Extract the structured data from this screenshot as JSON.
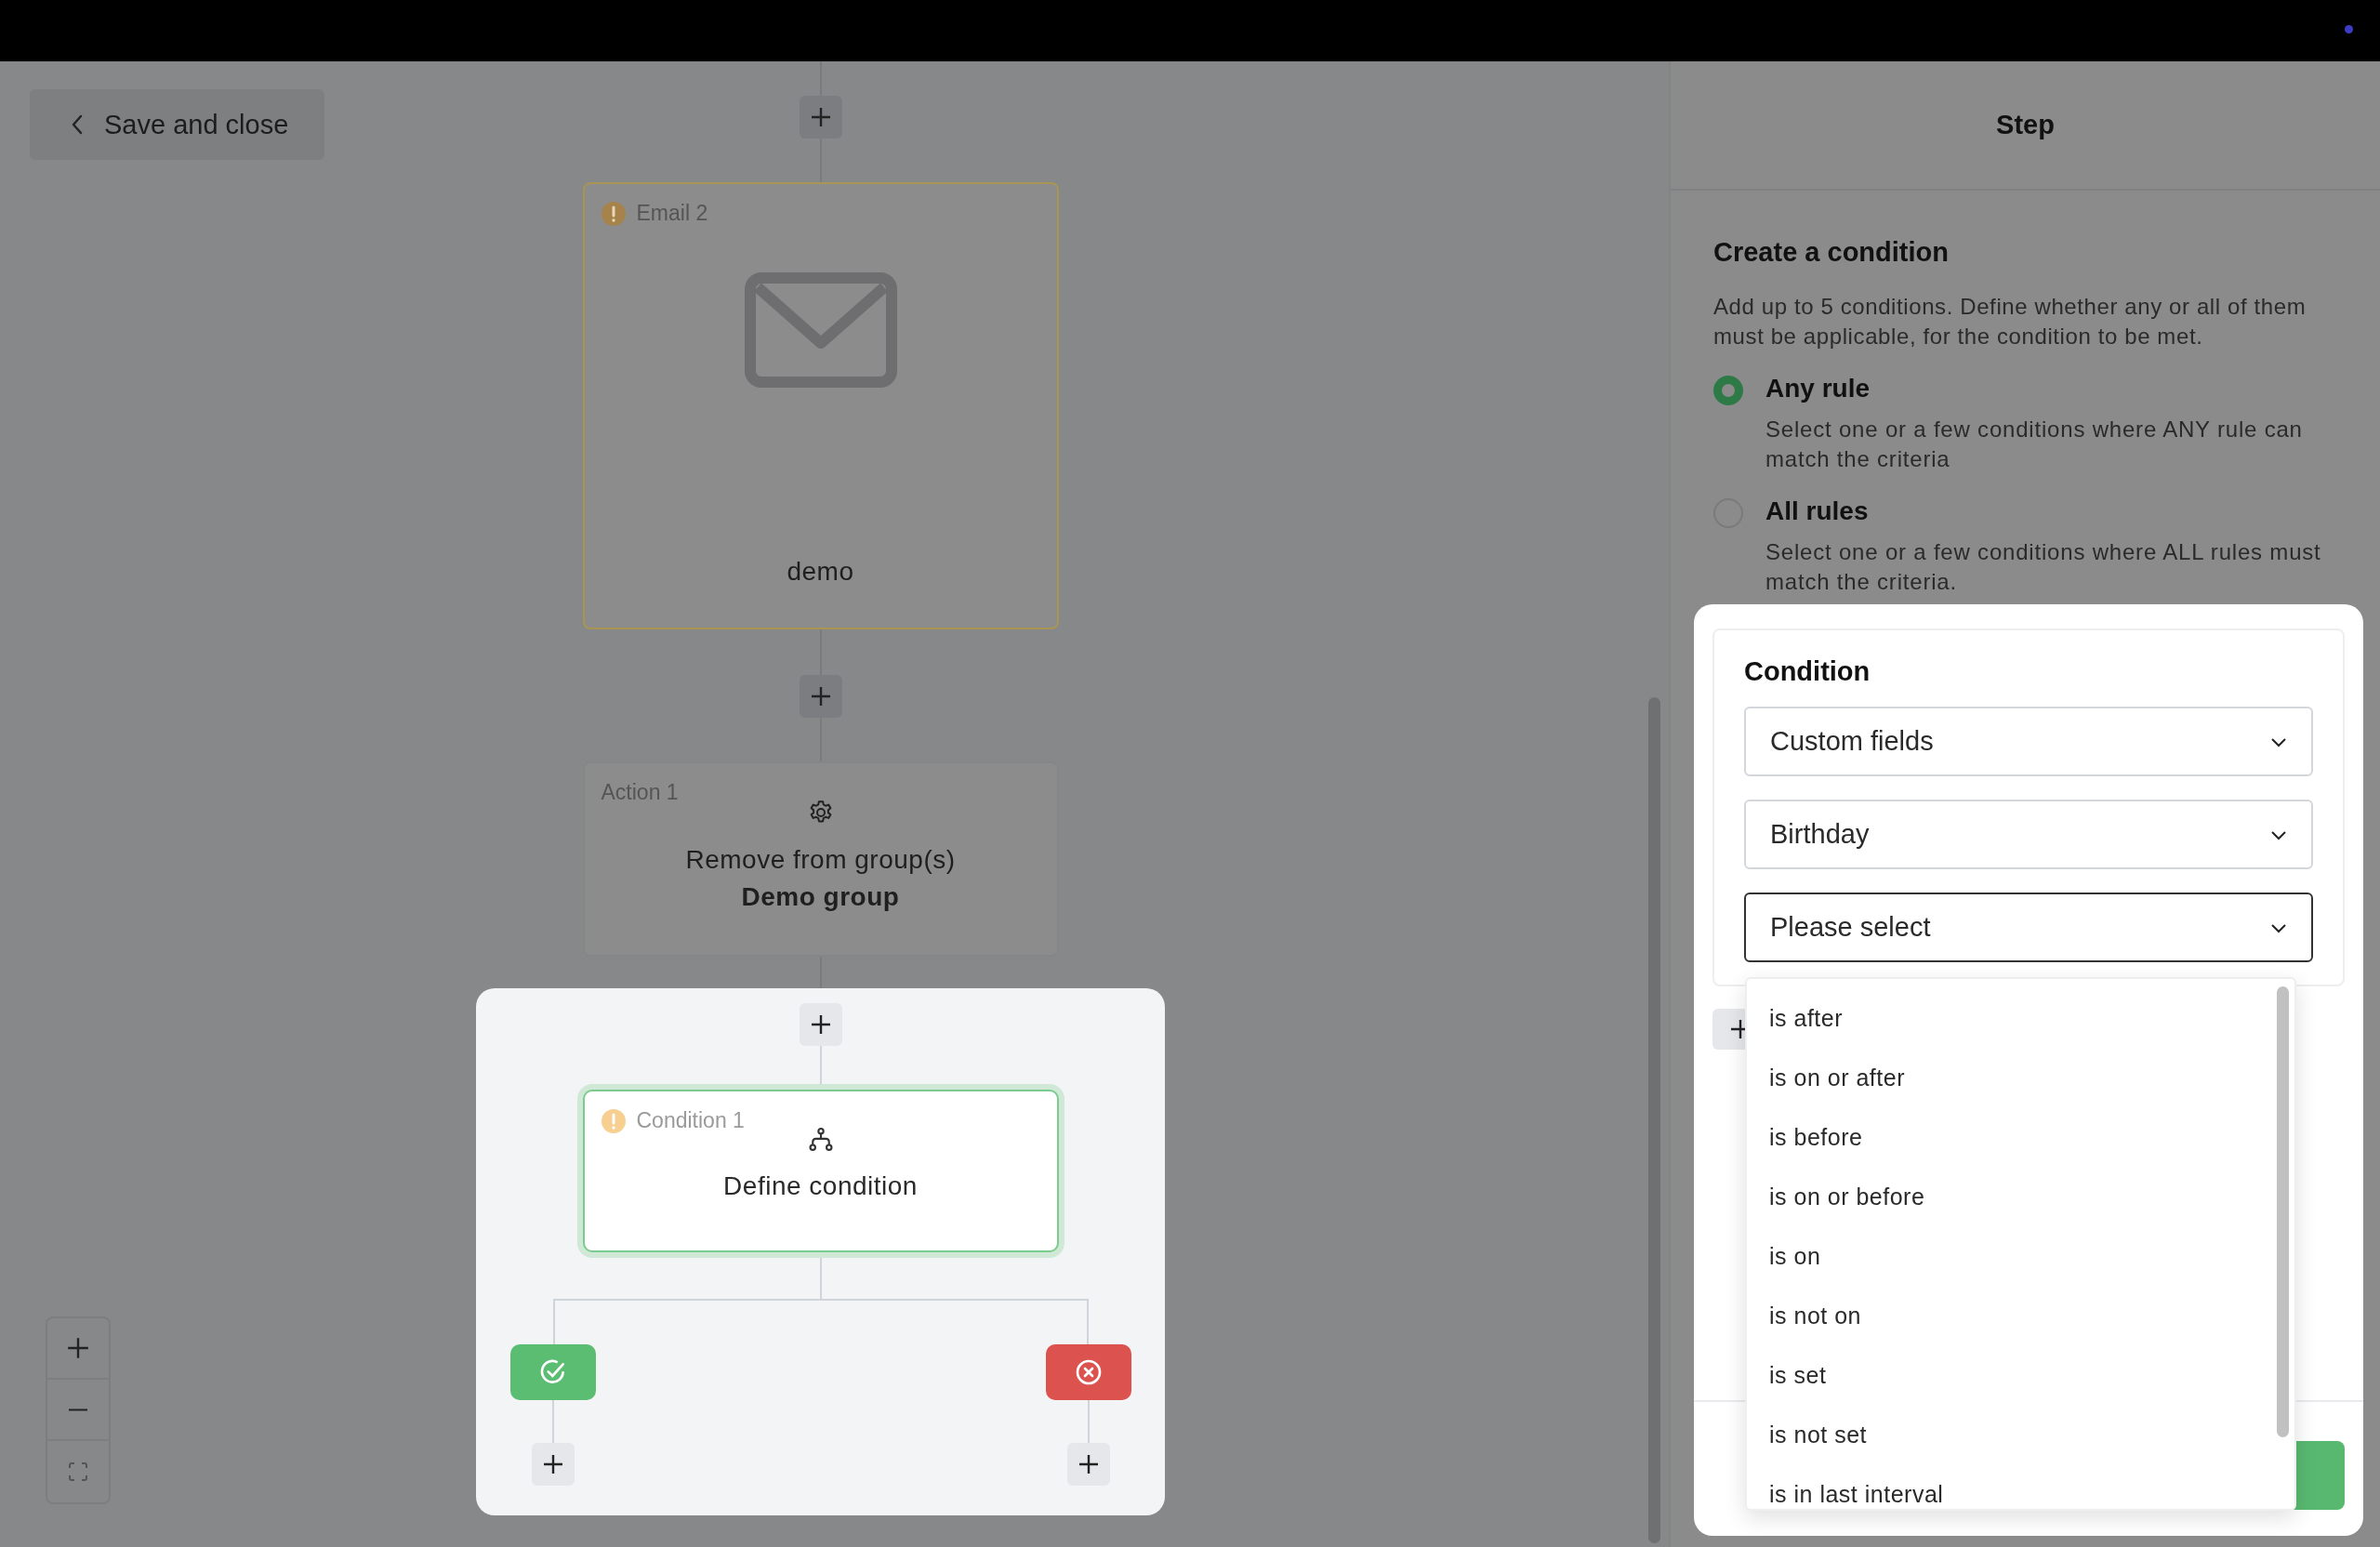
{
  "toolbar": {
    "back_button": "Save and close"
  },
  "flow": {
    "nodes": [
      {
        "kind": "email",
        "label": "Email 2",
        "warning": true,
        "title": "demo"
      },
      {
        "kind": "action",
        "label": "Action 1",
        "warning": false,
        "title": "Remove from group(s)",
        "subtitle": "Demo group"
      }
    ],
    "condition_node": {
      "label": "Condition 1",
      "warning": true,
      "title": "Define condition",
      "selected": true
    }
  },
  "panel": {
    "title": "Step",
    "section_title": "Create a condition",
    "description": "Add up to 5 conditions. Define whether any or all of them must be applicable, for the condition to be met.",
    "rules": [
      {
        "label": "Any rule",
        "description": "Select one or a few conditions where ANY rule can match the criteria",
        "selected": true
      },
      {
        "label": "All rules",
        "description": "Select one or a few conditions where ALL rules must match the criteria.",
        "selected": false
      }
    ],
    "condition": {
      "title": "Condition",
      "selects": [
        {
          "value": "Custom fields",
          "focused": false
        },
        {
          "value": "Birthday",
          "focused": false
        },
        {
          "placeholder": "Please select",
          "focused": true
        }
      ],
      "options": [
        "is after",
        "is on or after",
        "is before",
        "is on or before",
        "is on",
        "is not on",
        "is set",
        "is not set",
        "is in last interval"
      ]
    }
  }
}
